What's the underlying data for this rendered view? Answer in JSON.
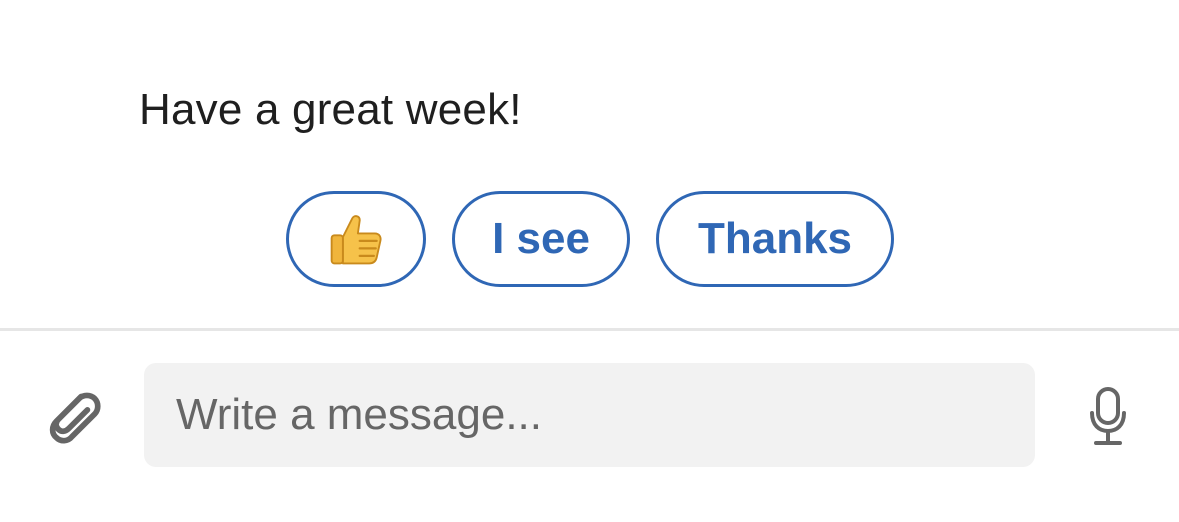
{
  "conversation": {
    "last_message": "Have a great week!"
  },
  "quick_replies": [
    {
      "label": "",
      "icon": "thumbs-up-icon"
    },
    {
      "label": "I see"
    },
    {
      "label": "Thanks"
    }
  ],
  "composer": {
    "placeholder": "Write a message...",
    "attach_icon": "paperclip-icon",
    "mic_icon": "microphone-icon"
  },
  "colors": {
    "accent": "#2f67b5",
    "text": "#1f1f1f",
    "placeholder": "#666666",
    "input_bg": "#f2f2f2",
    "divider": "#e6e6e6",
    "icon": "#666666"
  }
}
